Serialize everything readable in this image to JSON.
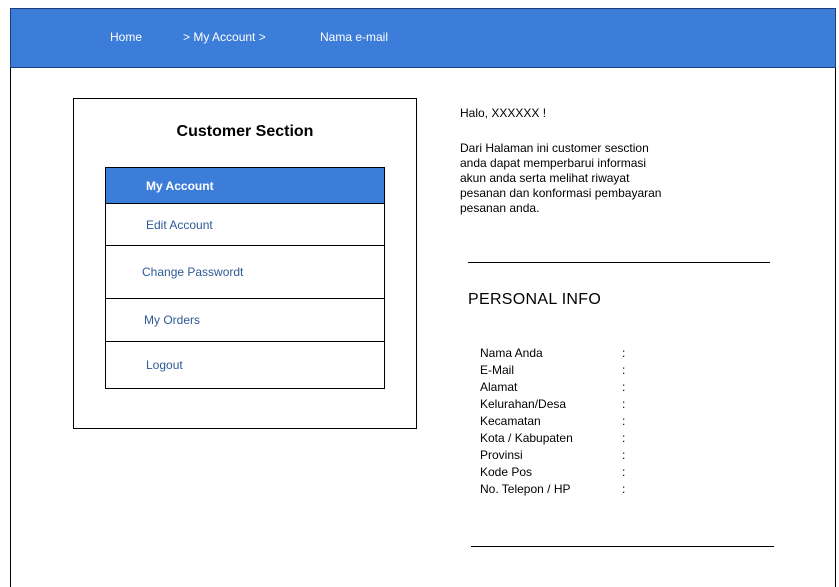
{
  "breadcrumb": {
    "home": "Home",
    "my_account": "> My Account >",
    "email": "Nama e-mail"
  },
  "colors": {
    "topbar": "#3b7dd8",
    "menu_active_bg": "#3b7dd8",
    "menu_text": "#2e5a96"
  },
  "sidebar": {
    "title": "Customer Section",
    "items": [
      {
        "label": "My Account",
        "active": true
      },
      {
        "label": "Edit Account",
        "active": false
      },
      {
        "label": "Change Passwordt",
        "active": false
      },
      {
        "label": "My Orders",
        "active": false
      },
      {
        "label": "Logout",
        "active": false
      }
    ]
  },
  "main": {
    "greeting": "Halo, XXXXXX !",
    "description": "Dari Halaman ini customer sesction anda dapat memperbarui informasi akun anda serta melihat riwayat pesanan dan konformasi pembayaran pesanan anda.",
    "personal_info": {
      "title": "PERSONAL INFO",
      "fields": [
        {
          "label": "Nama Anda",
          "sep": ":"
        },
        {
          "label": "E-Mail",
          "sep": ":"
        },
        {
          "label": "Alamat",
          "sep": ":"
        },
        {
          "label": "Kelurahan/Desa",
          "sep": ":"
        },
        {
          "label": "Kecamatan",
          "sep": ":"
        },
        {
          "label": "Kota / Kabupaten",
          "sep": ":"
        },
        {
          "label": "Provinsi",
          "sep": ":"
        },
        {
          "label": "Kode Pos",
          "sep": ":"
        },
        {
          "label": "No. Telepon / HP",
          "sep": ":"
        }
      ]
    }
  }
}
